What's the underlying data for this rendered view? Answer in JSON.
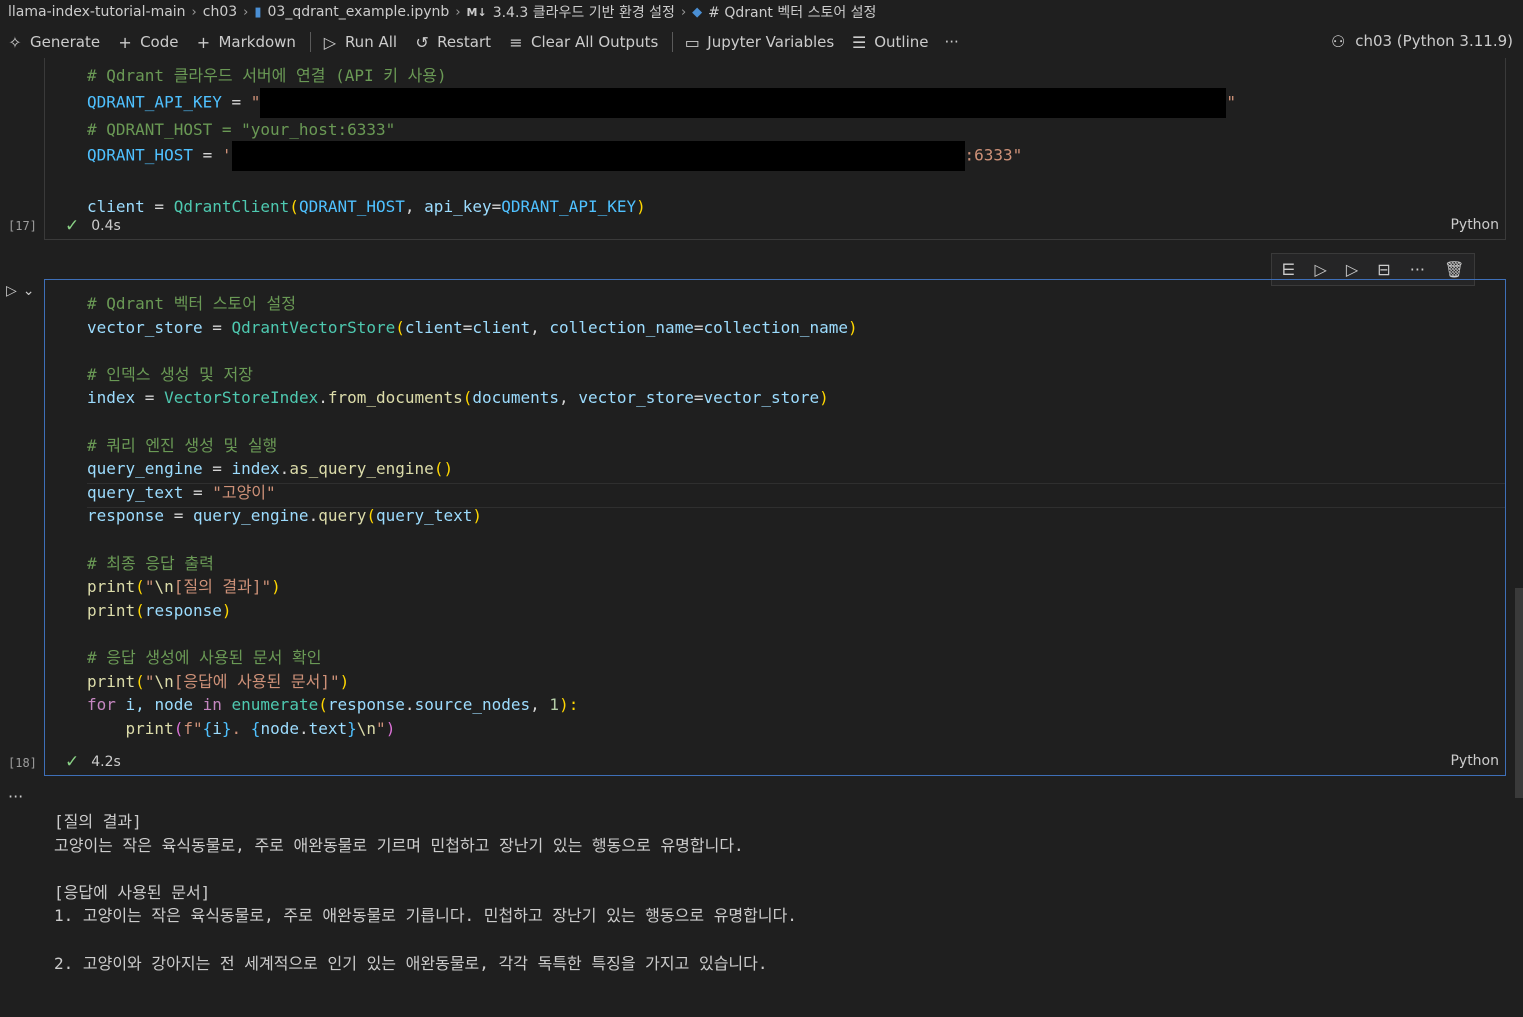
{
  "breadcrumb": {
    "folder": "llama-index-tutorial-main",
    "subfolder": "ch03",
    "file": "03_qdrant_example.ipynb",
    "md_badge": "M↓",
    "section": "3.4.3 클라우드 기반 환경 설정",
    "cell": "# Qdrant 벡터 스토어 설정"
  },
  "toolbar": {
    "generate": "Generate",
    "code": "Code",
    "markdown": "Markdown",
    "run_all": "Run All",
    "restart": "Restart",
    "clear_outputs": "Clear All Outputs",
    "jupyter_variables": "Jupyter Variables",
    "outline": "Outline",
    "more": "···",
    "kernel": "ch03 (Python 3.11.9)"
  },
  "cell17": {
    "exec_count": "[17]",
    "lines": {
      "c1": "# Qdrant 클라우드 서버에 연결 (API 키 사용)",
      "l2a": "QDRANT_API_KEY",
      "l2b": " = ",
      "l2c": "\"",
      "l2d": "\"",
      "c3": "# QDRANT_HOST = \"your_host:6333\"",
      "l4a": "QDRANT_HOST",
      "l4b": " = ",
      "l4c": "'",
      "l4d": ":6333\"",
      "l6a": "client",
      "l6b": " = ",
      "l6c": "QdrantClient",
      "l6d": "(",
      "l6e": "QDRANT_HOST",
      "l6f": ", ",
      "l6g": "api_key",
      "l6h": "=",
      "l6i": "QDRANT_API_KEY",
      "l6j": ")"
    },
    "status_time": "0.4s",
    "language": "Python"
  },
  "cell18": {
    "exec_count": "[18]",
    "status_time": "4.2s",
    "language": "Python",
    "lines": {
      "c1": "# Qdrant 벡터 스토어 설정",
      "vs1": "vector_store",
      "vs2": " = ",
      "vs3": "QdrantVectorStore",
      "vs4": "(",
      "vs5": "client",
      "vs6": "=",
      "vs7": "client",
      "vs8": ", ",
      "vs9": "collection_name",
      "vs10": "=",
      "vs11": "collection_name",
      "vs12": ")",
      "c2": "# 인덱스 생성 및 저장",
      "ix1": "index",
      "ix2": " = ",
      "ix3": "VectorStoreIndex",
      "ix4": ".",
      "ix5": "from_documents",
      "ix6": "(",
      "ix7": "documents",
      "ix8": ", ",
      "ix9": "vector_store",
      "ix10": "=",
      "ix11": "vector_store",
      "ix12": ")",
      "c3": "# 쿼리 엔진 생성 및 실행",
      "qe1": "query_engine",
      "qe2": " = ",
      "qe3": "index",
      "qe4": ".",
      "qe5": "as_query_engine",
      "qe6": "()",
      "qt1": "query_text",
      "qt2": " = ",
      "qt3": "\"고양이\"",
      "rs1": "response",
      "rs2": " = ",
      "rs3": "query_engine",
      "rs4": ".",
      "rs5": "query",
      "rs6": "(",
      "rs7": "query_text",
      "rs8": ")",
      "c4": "# 최종 응답 출력",
      "p1a": "print",
      "p1b": "(",
      "p1c": "\"",
      "p1d": "\\n",
      "p1e": "[질의 결과]\"",
      "p1f": ")",
      "p2a": "print",
      "p2b": "(",
      "p2c": "response",
      "p2d": ")",
      "c5": "# 응답 생성에 사용된 문서 확인",
      "p3a": "print",
      "p3b": "(",
      "p3c": "\"",
      "p3d": "\\n",
      "p3e": "[응답에 사용된 문서]\"",
      "p3f": ")",
      "fr1": "for",
      "fr2": " i, node ",
      "fr3": "in",
      "fr4": " ",
      "fr5": "enumerate",
      "fr6": "(",
      "fr7": "response",
      "fr8": ".",
      "fr9": "source_nodes",
      "fr10": ", ",
      "fr11": "1",
      "fr12": "):",
      "pf1": "print",
      "pf2": "(",
      "pf3": "f\"",
      "pf4": "{",
      "pf5": "i",
      "pf6": "}",
      "pf7": ". ",
      "pf8": "{",
      "pf9": "node",
      "pf10": ".",
      "pf11": "text",
      "pf12": "}",
      "pf13": "\\n",
      "pf14": "\"",
      "pf15": ")"
    }
  },
  "output": {
    "more": "···",
    "lines": [
      "[질의 결과]",
      "고양이는 작은 육식동물로, 주로 애완동물로 기르며 민첩하고 장난기 있는 행동으로 유명합니다.",
      "",
      "[응답에 사용된 문서]",
      "1. 고양이는 작은 육식동물로, 주로 애완동물로 기릅니다. 민첩하고 장난기 있는 행동으로 유명합니다.",
      "",
      "2. 고양이와 강아지는 전 세계적으로 인기 있는 애완동물로, 각각 독특한 특징을 가지고 있습니다."
    ]
  }
}
